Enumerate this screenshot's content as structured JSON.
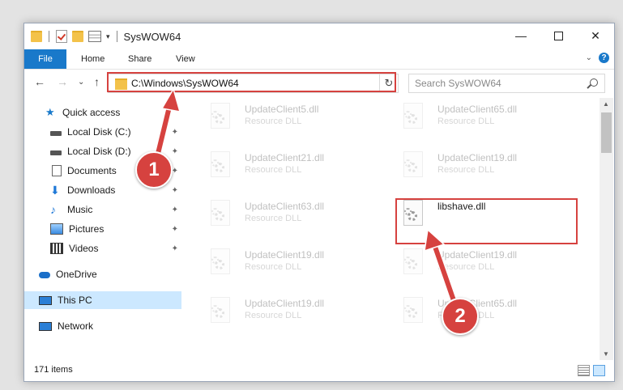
{
  "window": {
    "title": "SysWOW64",
    "qat_dropdown": "▾",
    "controls": {
      "minimize": "—",
      "maximize": "",
      "close": "✕"
    }
  },
  "ribbon": {
    "tabs": [
      "File",
      "Home",
      "Share",
      "View"
    ],
    "expand": "⌄",
    "help": "?"
  },
  "nav": {
    "back": "←",
    "forward": "→",
    "recent": "⌄",
    "up": "↑",
    "address": "C:\\Windows\\SysWOW64",
    "address_dropdown": "⌄",
    "refresh": "↻",
    "search_placeholder": "Search SysWOW64"
  },
  "sidebar": {
    "items": [
      {
        "label": "Quick access",
        "icon": "star-icon"
      },
      {
        "label": "Local Disk (C:)",
        "icon": "drive-icon",
        "pinned": true
      },
      {
        "label": "Local Disk (D:)",
        "icon": "drive-icon",
        "pinned": true
      },
      {
        "label": "Documents",
        "icon": "documents-icon",
        "pinned": true
      },
      {
        "label": "Downloads",
        "icon": "download-icon",
        "pinned": true
      },
      {
        "label": "Music",
        "icon": "music-icon",
        "pinned": true
      },
      {
        "label": "Pictures",
        "icon": "pictures-icon",
        "pinned": true
      },
      {
        "label": "Videos",
        "icon": "videos-icon",
        "pinned": true
      },
      {
        "label": "OneDrive",
        "icon": "cloud-icon"
      },
      {
        "label": "This PC",
        "icon": "computer-icon",
        "selected": true
      },
      {
        "label": "Network",
        "icon": "network-icon"
      }
    ]
  },
  "files": [
    {
      "name": "UpdateClient5.dll",
      "type": "Resource DLL"
    },
    {
      "name": "UpdateClient65.dll",
      "type": "Resource DLL"
    },
    {
      "name": "UpdateClient21.dll",
      "type": "Resource DLL"
    },
    {
      "name": "UpdateClient19.dll",
      "type": "Resource DLL"
    },
    {
      "name": "UpdateClient63.dll",
      "type": "Resource DLL"
    },
    {
      "name": "libshave.dll",
      "type": ""
    },
    {
      "name": "UpdateClient19.dll",
      "type": "Resource DLL"
    },
    {
      "name": "UpdateClient19.dll",
      "type": "Resource DLL"
    },
    {
      "name": "UpdateClient19.dll",
      "type": "Resource DLL"
    },
    {
      "name": "UpdateClient65.dll",
      "type": "Resource DLL"
    }
  ],
  "status": {
    "item_count": "171 items"
  },
  "annotations": {
    "step1": "1",
    "step2": "2",
    "color": "#d6423f"
  }
}
